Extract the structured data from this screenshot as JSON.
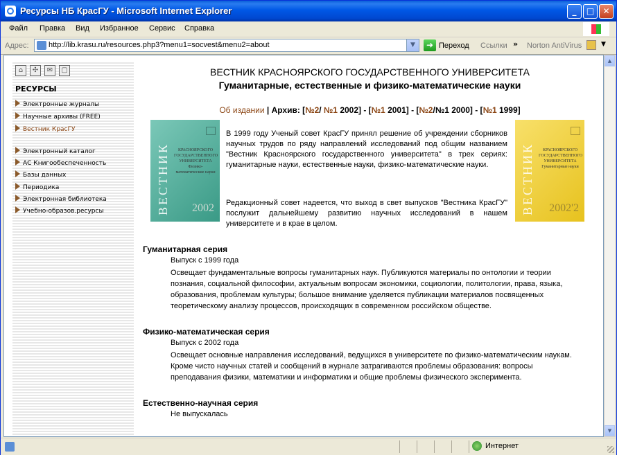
{
  "window": {
    "title": "Ресурсы НБ КрасГУ - Microsoft Internet Explorer"
  },
  "menu": [
    "Файл",
    "Правка",
    "Вид",
    "Избранное",
    "Сервис",
    "Справка"
  ],
  "address": {
    "label": "Адрес:",
    "url": "http://lib.krasu.ru/resources.php3?menu1=socvest&menu2=about",
    "go": "Переход",
    "links": "Ссылки",
    "norton": "Norton AntiVirus"
  },
  "status": {
    "zone": "Интернет"
  },
  "sidebar": {
    "heading": "РЕСУРСЫ",
    "items": [
      "Электронные журналы",
      "Научные архивы (FREE)",
      "Вестник КрасГУ",
      "Электронный каталог",
      "АС Книгообеспеченность",
      "Базы данных",
      "Периодика",
      "Электронная библиотека",
      "Учебно-образов.ресурсы"
    ]
  },
  "page": {
    "title": "ВЕСТНИК КРАСНОЯРСКОГО ГОСУДАРСТВЕННОГО УНИВЕРСИТЕТА",
    "subtitle": "Гуманитарные, естественные и физико-математические науки",
    "about": "Об издании",
    "archive_label": "Архив:",
    "cover1": {
      "vert": "ВЕСТНИК",
      "text": "КРАСНОЯРСКОГО ГОСУДАРСТВЕННОГО УНИВЕРСИТЕТА Физико-математические науки",
      "year": "2002"
    },
    "cover2": {
      "vert": "ВЕСТНИК",
      "text": "КРАСНОЯРСКОГО ГОСУДАРСТВЕННОГО УНИВЕРСИТЕТА Гуманитарные науки",
      "year": "2002'2"
    },
    "para1": "В 1999 году Ученый совет КрасГУ принял решение об учреждении сборников научных трудов по ряду направлений исследований под общим названием \"Вестник Красноярского государственного университета\" в трех сериях: гуманитарные науки, естественные науки, физико-математические науки.",
    "para2": "Редакционный совет надеется, что выход в свет выпусков \"Вестника КрасГУ\" послужит дальнейшему развитию научных исследований в нашем университете и в крае в целом.",
    "series": [
      {
        "name": "Гуманитарная серия",
        "since": "Выпуск с 1999 года",
        "desc": "Освещает фундаментальные вопросы гуманитарных наук. Публикуются материалы по онтологии и теории познания, социальной философии, актуальным вопросам экономики, социологии, политологии, права, языка, образования, проблемам культуры; большое внимание уделяется публикации материалов посвященных теоретическому анализу процессов, происходящих в современном российском обществе."
      },
      {
        "name": "Физико-математическая серия",
        "since": "Выпуск с 2002 года",
        "desc": "Освещает основные направления исследований, ведущихся в университете по физико-математическим наукам. Кроме чисто научных статей и сообщений в журнале затрагиваются проблемы образования: вопросы преподавания физики, математики и информатики и общие проблемы физического эксперимента."
      },
      {
        "name": "Естественно-научная серия",
        "since": "Не выпускалась"
      }
    ]
  }
}
